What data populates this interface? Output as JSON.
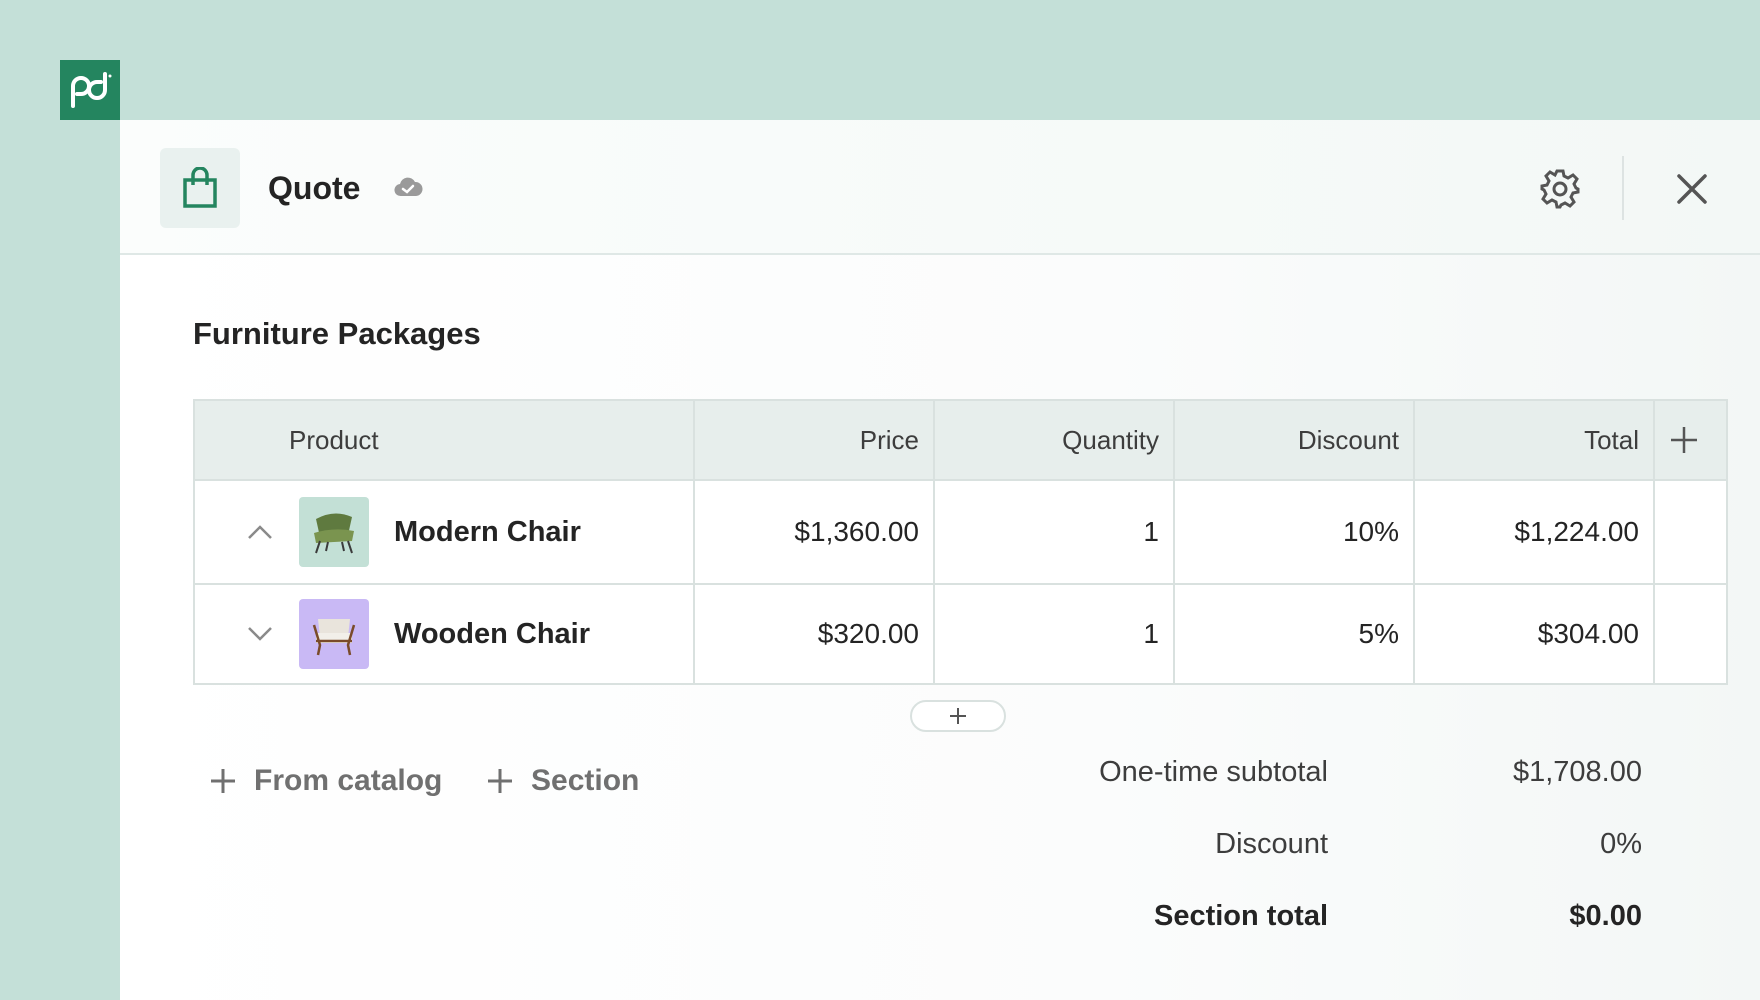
{
  "app": {
    "logo_icon": "pandadoc-logo-icon",
    "brand_color": "#24855f"
  },
  "header": {
    "title": "Quote",
    "title_icon": "shopping-bag-icon",
    "sync_icon": "cloud-check-icon",
    "settings_icon": "gear-icon",
    "close_icon": "close-icon"
  },
  "section": {
    "title": "Furniture Packages"
  },
  "table": {
    "columns": [
      "Product",
      "Price",
      "Quantity",
      "Discount",
      "Total"
    ],
    "rows": [
      {
        "name": "Modern Chair",
        "price": "$1,360.00",
        "quantity": "1",
        "discount": "10%",
        "total": "$1,224.00",
        "thumb_color": "#c3e0d6",
        "chevron": "chevron-up-icon"
      },
      {
        "name": "Wooden Chair",
        "price": "$320.00",
        "quantity": "1",
        "discount": "5%",
        "total": "$304.00",
        "thumb_color": "#c9b9f5",
        "chevron": "chevron-down-icon"
      }
    ]
  },
  "actions": {
    "from_catalog": "From catalog",
    "section": "Section"
  },
  "summary": {
    "subtotal_label": "One-time subtotal",
    "subtotal_value": "$1,708.00",
    "discount_label": "Discount",
    "discount_value": "0%",
    "total_label": "Section total",
    "total_value": "$0.00"
  }
}
